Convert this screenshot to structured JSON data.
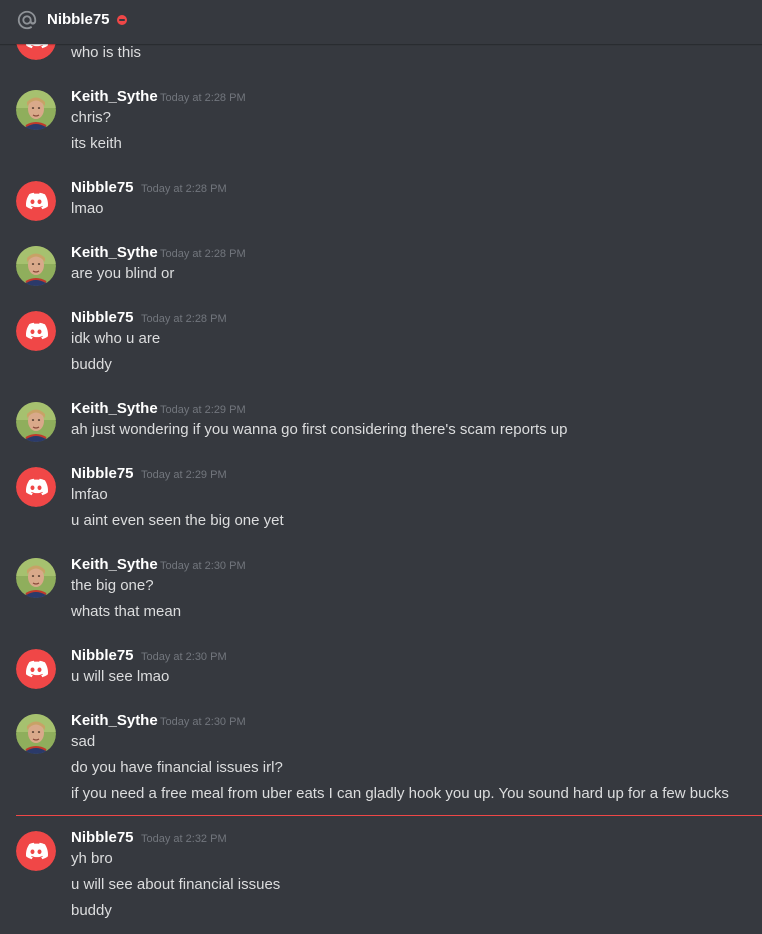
{
  "header": {
    "name": "Nibble75",
    "status": "do-not-disturb",
    "icon": "at-icon"
  },
  "colors": {
    "background": "#36393f",
    "discord_red": "#f04747",
    "text": "#dcddde",
    "timestamp": "#72767d",
    "author": "#ffffff"
  },
  "top_partial": {
    "text": "who is this"
  },
  "groups": [
    {
      "author": "Keith_Sythe",
      "avatar": "keith-avatar",
      "time": "Today at 2:28 PM",
      "lines": [
        "chris?",
        "its keith"
      ]
    },
    {
      "author": "Nibble75",
      "avatar": "discord-logo-avatar",
      "time": "Today at 2:28 PM",
      "lines": [
        "lmao"
      ]
    },
    {
      "author": "Keith_Sythe",
      "avatar": "keith-avatar",
      "time": "Today at 2:28 PM",
      "lines": [
        "are you blind or"
      ]
    },
    {
      "author": "Nibble75",
      "avatar": "discord-logo-avatar",
      "time": "Today at 2:28 PM",
      "lines": [
        "idk who u are",
        "buddy"
      ]
    },
    {
      "author": "Keith_Sythe",
      "avatar": "keith-avatar",
      "time": "Today at 2:29 PM",
      "lines": [
        "ah just wondering if you wanna go first considering there's scam reports up"
      ]
    },
    {
      "author": "Nibble75",
      "avatar": "discord-logo-avatar",
      "time": "Today at 2:29 PM",
      "lines": [
        "lmfao",
        "u aint even seen the big one yet"
      ]
    },
    {
      "author": "Keith_Sythe",
      "avatar": "keith-avatar",
      "time": "Today at 2:30 PM",
      "lines": [
        "the big one?",
        "whats that mean"
      ]
    },
    {
      "author": "Nibble75",
      "avatar": "discord-logo-avatar",
      "time": "Today at 2:30 PM",
      "lines": [
        "u will see lmao"
      ]
    },
    {
      "author": "Keith_Sythe",
      "avatar": "keith-avatar",
      "time": "Today at 2:30 PM",
      "lines": [
        "sad",
        "do you have financial issues irl?",
        "if you need a free meal from uber eats I can gladly hook you up. You sound hard up for a few bucks"
      ]
    },
    {
      "author": "Nibble75",
      "avatar": "discord-logo-avatar",
      "time": "Today at 2:32 PM",
      "lines": [
        "yh bro",
        "u will see about financial issues",
        "buddy"
      ]
    }
  ]
}
